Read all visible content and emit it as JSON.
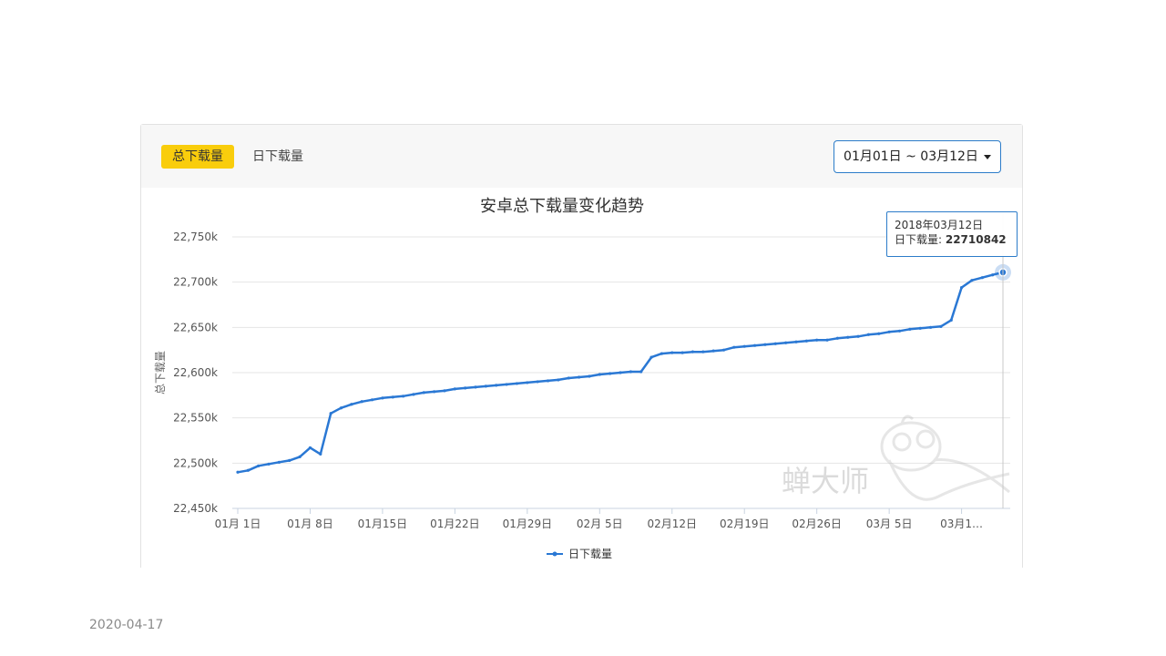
{
  "tabs": [
    {
      "label": "总下载量",
      "active": true
    },
    {
      "label": "日下载量",
      "active": false
    }
  ],
  "date_range": {
    "label": "01月01日 ~ 03月12日"
  },
  "footer_date": "2020-04-17",
  "tooltip": {
    "title": "2018年03月12日",
    "series_label": "日下载量: ",
    "value": "22710842"
  },
  "watermark": {
    "text": "蝉大师"
  },
  "colors": {
    "line": "#2a78d4",
    "accent": "#f9cd0c",
    "border": "#2c7cc9"
  },
  "chart_data": {
    "type": "line",
    "title": "安卓总下载量变化趋势",
    "ylabel": "总下载量",
    "xlabel": "",
    "ylim": [
      22450,
      22750
    ],
    "y_ticks": [
      "22,450k",
      "22,500k",
      "22,550k",
      "22,600k",
      "22,650k",
      "22,700k",
      "22,750k"
    ],
    "y_tick_values": [
      22450,
      22500,
      22550,
      22600,
      22650,
      22700,
      22750
    ],
    "x_tick_labels": [
      "01月 1日",
      "01月 8日",
      "01月15日",
      "01月22日",
      "01月29日",
      "02月 5日",
      "02月12日",
      "02月19日",
      "02月26日",
      "03月 5日",
      "03月1…"
    ],
    "x_tick_days": [
      0,
      7,
      14,
      21,
      28,
      35,
      42,
      49,
      56,
      63,
      70
    ],
    "legend": "top",
    "grid": true,
    "series": [
      {
        "name": "日下载量",
        "values": [
          22490,
          22492,
          22497,
          22499,
          22501,
          22503,
          22507,
          22517,
          22510,
          22555,
          22561,
          22565,
          22568,
          22570,
          22572,
          22573,
          22574,
          22576,
          22578,
          22579,
          22580,
          22582,
          22583,
          22584,
          22585,
          22586,
          22587,
          22588,
          22589,
          22590,
          22591,
          22592,
          22594,
          22595,
          22596,
          22598,
          22599,
          22600,
          22601,
          22601,
          22617,
          22621,
          22622,
          22622,
          22623,
          22623,
          22624,
          22625,
          22628,
          22629,
          22630,
          22631,
          22632,
          22633,
          22634,
          22635,
          22636,
          22636,
          22638,
          22639,
          22640,
          22642,
          22643,
          22645,
          22646,
          22648,
          22649,
          22650,
          22651,
          22658,
          22694,
          22702,
          22705,
          22708,
          22710.842
        ]
      }
    ]
  }
}
